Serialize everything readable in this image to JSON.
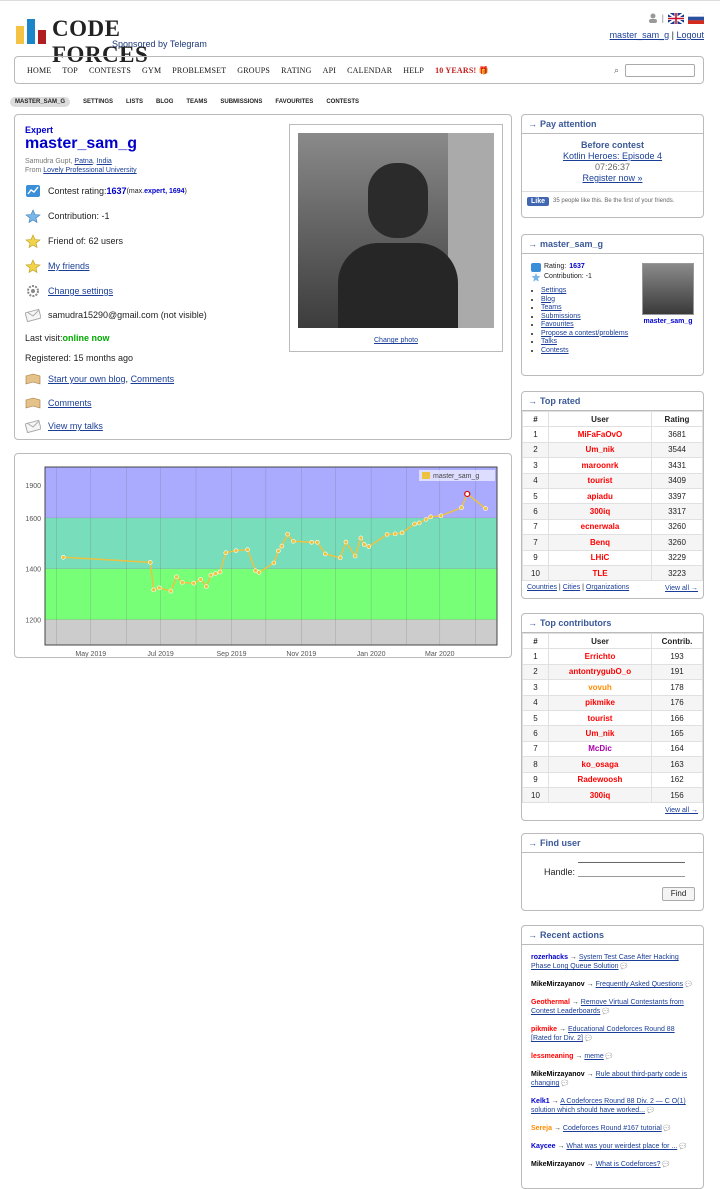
{
  "logo": {
    "title": "CODE FORCES",
    "subtitle": "Sponsored by Telegram"
  },
  "header": {
    "user": "master_sam_g",
    "separator": "|",
    "logout": "Logout"
  },
  "menu": {
    "items": [
      "HOME",
      "TOP",
      "CONTESTS",
      "GYM",
      "PROBLEMSET",
      "GROUPS",
      "RATING",
      "API",
      "CALENDAR",
      "HELP"
    ],
    "special": "10 YEARS! 🎁"
  },
  "subtabs": [
    "MASTER_SAM_G",
    "SETTINGS",
    "LISTS",
    "BLOG",
    "TEAMS",
    "SUBMISSIONS",
    "FAVOURITES",
    "CONTESTS"
  ],
  "profile": {
    "rank": "Expert",
    "handle": "master_sam_g",
    "name_prefix": "Samudra Gupt, ",
    "city": "Patna",
    "sep": ", ",
    "country": "India",
    "from_prefix": "From ",
    "org": "Lovely Professional University",
    "rating_label": "Contest rating: ",
    "rating": "1637",
    "max_prefix": " (max. ",
    "max_rank": "expert, 1694",
    "max_suffix": ")",
    "contribution": "Contribution: -1",
    "friend_of": "Friend of: 62 users",
    "my_friends": "My friends",
    "change_settings": "Change settings",
    "email": "samudra15290@gmail.com (not visible)",
    "last_visit_label": "Last visit: ",
    "last_visit": "online now",
    "registered": "Registered: 15 months ago",
    "blog_link": "Start your own blog",
    "comments": "Comments",
    "comments2": "Comments",
    "talks": "View my talks",
    "change_photo": "Change photo"
  },
  "chart_data": {
    "type": "line",
    "series": [
      {
        "name": "master_sam_g",
        "values": [
          {
            "x": "2019-04-07",
            "y": 1445
          },
          {
            "x": "2019-06-22",
            "y": 1425
          },
          {
            "x": "2019-06-25",
            "y": 1317
          },
          {
            "x": "2019-06-30",
            "y": 1325
          },
          {
            "x": "2019-07-10",
            "y": 1312
          },
          {
            "x": "2019-07-15",
            "y": 1368
          },
          {
            "x": "2019-07-20",
            "y": 1346
          },
          {
            "x": "2019-07-30",
            "y": 1343
          },
          {
            "x": "2019-08-05",
            "y": 1358
          },
          {
            "x": "2019-08-10",
            "y": 1330
          },
          {
            "x": "2019-08-14",
            "y": 1375
          },
          {
            "x": "2019-08-18",
            "y": 1381
          },
          {
            "x": "2019-08-22",
            "y": 1387
          },
          {
            "x": "2019-08-27",
            "y": 1463
          },
          {
            "x": "2019-09-05",
            "y": 1471
          },
          {
            "x": "2019-09-15",
            "y": 1475
          },
          {
            "x": "2019-09-22",
            "y": 1392
          },
          {
            "x": "2019-09-25",
            "y": 1385
          },
          {
            "x": "2019-10-08",
            "y": 1423
          },
          {
            "x": "2019-10-12",
            "y": 1470
          },
          {
            "x": "2019-10-15",
            "y": 1489
          },
          {
            "x": "2019-10-20",
            "y": 1536
          },
          {
            "x": "2019-10-25",
            "y": 1508
          },
          {
            "x": "2019-11-10",
            "y": 1504
          },
          {
            "x": "2019-11-15",
            "y": 1504
          },
          {
            "x": "2019-11-22",
            "y": 1458
          },
          {
            "x": "2019-12-05",
            "y": 1443
          },
          {
            "x": "2019-12-10",
            "y": 1505
          },
          {
            "x": "2019-12-18",
            "y": 1450
          },
          {
            "x": "2019-12-23",
            "y": 1521
          },
          {
            "x": "2019-12-26",
            "y": 1495
          },
          {
            "x": "2019-12-30",
            "y": 1487
          },
          {
            "x": "2020-01-15",
            "y": 1535
          },
          {
            "x": "2020-01-22",
            "y": 1537
          },
          {
            "x": "2020-01-28",
            "y": 1541
          },
          {
            "x": "2020-02-08",
            "y": 1576
          },
          {
            "x": "2020-02-12",
            "y": 1580
          },
          {
            "x": "2020-02-18",
            "y": 1594
          },
          {
            "x": "2020-02-22",
            "y": 1604
          },
          {
            "x": "2020-03-02",
            "y": 1608
          },
          {
            "x": "2020-03-20",
            "y": 1640
          },
          {
            "x": "2020-03-25",
            "y": 1694
          },
          {
            "x": "2020-04-10",
            "y": 1637
          }
        ]
      }
    ],
    "xticks": [
      "May 2019",
      "Jul 2019",
      "Sep 2019",
      "Nov 2019",
      "Jan 2020",
      "Mar 2020"
    ],
    "yticks": [
      "1200",
      "1400",
      "1600",
      "1900"
    ],
    "ylim": [
      1100,
      1800
    ],
    "bands": [
      {
        "from": 1100,
        "to": 1200,
        "color": "#cccccc"
      },
      {
        "from": 1200,
        "to": 1400,
        "color": "#77ff77"
      },
      {
        "from": 1400,
        "to": 1600,
        "color": "#77ddbb"
      },
      {
        "from": 1600,
        "to": 1900,
        "color": "#aaaaff"
      },
      {
        "from": 1900,
        "to": 2100,
        "color": "#ff88ff"
      }
    ],
    "legend_position": "top-right",
    "line_color": "#edc240"
  },
  "pay": {
    "title": "Pay attention",
    "before": "Before contest",
    "contest": "Kotlin Heroes: Episode 4",
    "timer": "07:26:37",
    "register": "Register now »",
    "fb": "Like",
    "fb_text": "35 people like this. Be the first of your friends."
  },
  "userbox": {
    "title": "master_sam_g",
    "rating_label": "Rating: ",
    "rating": "1637",
    "contribution": "Contribution: -1",
    "links": [
      "Settings",
      "Blog",
      "Teams",
      "Submissions",
      "Favourites",
      "Propose a contest/problems",
      "Talks",
      "Contests"
    ],
    "avatar_name": "master_sam_g"
  },
  "toprated": {
    "title": "Top rated",
    "headers": [
      "#",
      "User",
      "Rating"
    ],
    "rows": [
      [
        "1",
        "MiFaFaOvO",
        "3681",
        "#ff0000"
      ],
      [
        "2",
        "Um_nik",
        "3544",
        "#ff0000"
      ],
      [
        "3",
        "maroonrk",
        "3431",
        "#ff0000"
      ],
      [
        "4",
        "tourist",
        "3409",
        "#ff0000"
      ],
      [
        "5",
        "apiadu",
        "3397",
        "#ff0000"
      ],
      [
        "6",
        "300iq",
        "3317",
        "#ff0000"
      ],
      [
        "7",
        "ecnerwala",
        "3260",
        "#ff0000"
      ],
      [
        "7",
        "Benq",
        "3260",
        "#ff0000"
      ],
      [
        "9",
        "LHiC",
        "3229",
        "#ff0000"
      ],
      [
        "10",
        "TLE",
        "3223",
        "#ff0000"
      ]
    ],
    "foot": [
      "Countries",
      "Cities",
      "Organizations"
    ],
    "viewall": "View all →"
  },
  "topcontrib": {
    "title": "Top contributors",
    "headers": [
      "#",
      "User",
      "Contrib."
    ],
    "rows": [
      [
        "1",
        "Errichto",
        "193",
        "#ff0000"
      ],
      [
        "2",
        "antontrygubO_o",
        "191",
        "#ff0000"
      ],
      [
        "3",
        "vovuh",
        "178",
        "#ff8c00"
      ],
      [
        "4",
        "pikmike",
        "176",
        "#ff0000"
      ],
      [
        "5",
        "tourist",
        "166",
        "#ff0000"
      ],
      [
        "6",
        "Um_nik",
        "165",
        "#ff0000"
      ],
      [
        "7",
        "McDic",
        "164",
        "#aa00aa"
      ],
      [
        "8",
        "ko_osaga",
        "163",
        "#ff0000"
      ],
      [
        "9",
        "Radewoosh",
        "162",
        "#ff0000"
      ],
      [
        "10",
        "300iq",
        "156",
        "#ff0000"
      ]
    ],
    "viewall": "View all →"
  },
  "finduser": {
    "title": "Find user",
    "label": "Handle:",
    "button": "Find"
  },
  "recent": {
    "title": "Recent actions",
    "items": [
      {
        "user": "rozerhacks",
        "color": "#0000cc",
        "post": "System Test Case After Hacking Phase Long Queue Solution"
      },
      {
        "user": "MikeMirzayanov",
        "color": "#000000",
        "post": "Frequently Asked Questions"
      },
      {
        "user": "Geothermal",
        "color": "#ff0000",
        "post": "Remove Virtual Contestants from Contest Leaderboards"
      },
      {
        "user": "pikmike",
        "color": "#ff0000",
        "post": "Educational Codeforces Round 88 [Rated for Div. 2]"
      },
      {
        "user": "lessmeaning",
        "color": "#ff0000",
        "post": "meme"
      },
      {
        "user": "MikeMirzayanov",
        "color": "#000000",
        "post": "Rule about third-party code is changing"
      },
      {
        "user": "Kelk1",
        "color": "#0000cc",
        "post": "A Codeforces Round 88 Div. 2 — C O(1) solution which should have worked..."
      },
      {
        "user": "Sereja",
        "color": "#ff8c00",
        "post": "Codeforces Round #167 tutorial"
      },
      {
        "user": "Kaycee",
        "color": "#0000cc",
        "post": "What was your weirdest place for ..."
      },
      {
        "user": "MikeMirzayanov",
        "color": "#000000",
        "post": "What is Codeforces?"
      }
    ]
  }
}
